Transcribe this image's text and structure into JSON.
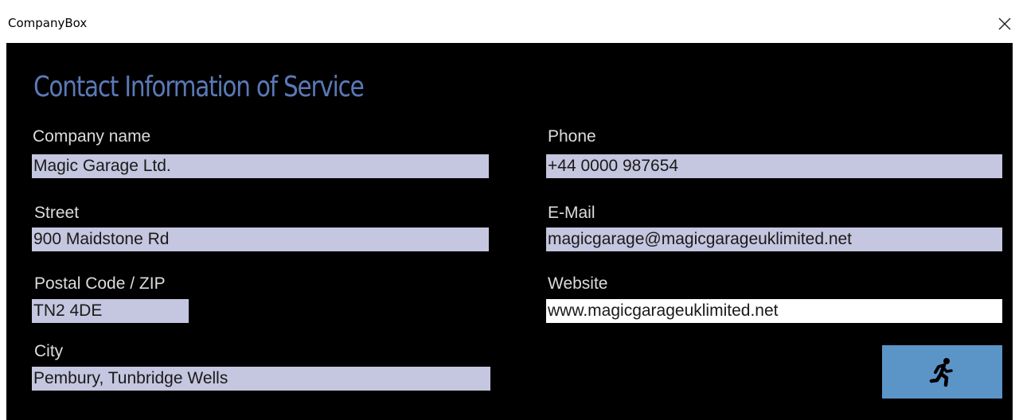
{
  "window": {
    "title": "CompanyBox"
  },
  "heading": "Contact Information of Service",
  "fields": {
    "company_name": {
      "label": "Company name",
      "value": "Magic Garage Ltd."
    },
    "street": {
      "label": "Street",
      "value": "900 Maidstone Rd"
    },
    "postal_code": {
      "label": "Postal Code / ZIP",
      "value": "TN2 4DE"
    },
    "city": {
      "label": "City",
      "value": "Pembury, Tunbridge Wells"
    },
    "phone": {
      "label": "Phone",
      "value": "+44 0000 987654"
    },
    "email": {
      "label": "E-Mail",
      "value": "magicgarage@magicgarageuklimited.net"
    },
    "website": {
      "label": "Website",
      "value": "www.magicgarageuklimited.net"
    }
  },
  "icons": {
    "close": "close-icon",
    "run": "running-person-icon"
  },
  "colors": {
    "background": "#000000",
    "heading": "#5b79b6",
    "field_background": "#c5c6df",
    "active_field_background": "#ffffff",
    "button": "#5b95c8"
  }
}
